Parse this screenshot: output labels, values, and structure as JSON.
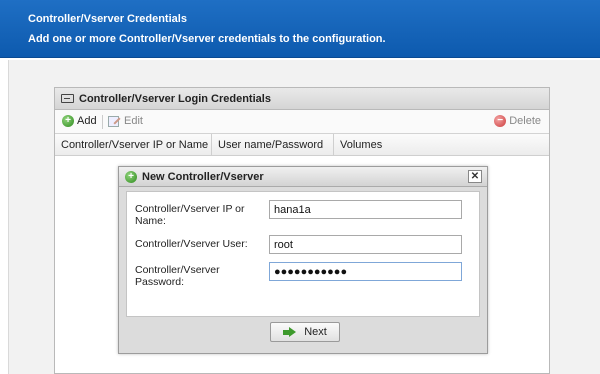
{
  "header": {
    "title": "Controller/Vserver Credentials",
    "subtitle": "Add one or more Controller/Vserver credentials to the configuration."
  },
  "panel": {
    "title": "Controller/Vserver Login Credentials",
    "toolbar": {
      "add_label": "Add",
      "edit_label": "Edit",
      "delete_label": "Delete"
    },
    "columns": [
      "Controller/Vserver IP or Name",
      "User name/Password",
      "Volumes"
    ]
  },
  "dialog": {
    "title": "New Controller/Vserver",
    "close_glyph": "✕",
    "fields": {
      "ip_label": "Controller/Vserver IP or Name:",
      "ip_value": "hana1a",
      "user_label": "Controller/Vserver User:",
      "user_value": "root",
      "password_label": "Controller/Vserver Password:",
      "password_value": "●●●●●●●●●●●"
    },
    "next_label": "Next"
  },
  "icons": {
    "add": "plus-circle-icon",
    "edit": "edit-icon",
    "delete": "minus-circle-icon",
    "panel": "window-icon",
    "dialog": "plus-circle-icon",
    "next": "arrow-right-icon"
  },
  "colors": {
    "header_bg": "#1565c0",
    "accent_green": "#3d9a2c",
    "delete_red": "#cc3b3b"
  }
}
